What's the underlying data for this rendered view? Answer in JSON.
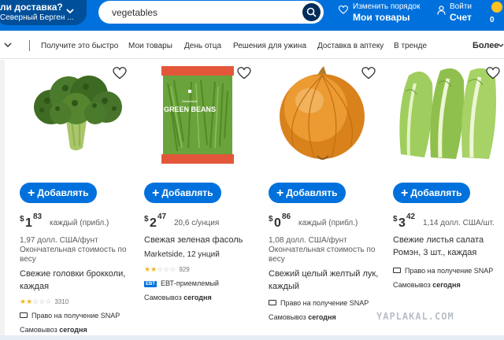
{
  "header": {
    "delivery_line1": "ли доставка?",
    "delivery_line2": "Северный Берген ...",
    "search_value": "vegetables",
    "reorder_small": "Изменить порядок",
    "reorder_big": "Мои товары",
    "account_small": "Войти",
    "account_big": "Счет",
    "cart_price": "0"
  },
  "nav": {
    "items": [
      "Получите это быстро",
      "Мои товары",
      "День отца",
      "Решения для ужина",
      "Доставка в аптеку",
      "В тренде"
    ],
    "more_label": "Более"
  },
  "products": [
    {
      "add_label": "Добавлять",
      "price_currency": "$",
      "price_dollars": "1",
      "price_cents": "83",
      "price_note": "каждый (прибл.)",
      "unit_price": "1,97 долл. США/фунт",
      "weight_note": "Окончательная стоимость по весу",
      "name": "Свежие головки брокколи, каждая",
      "rating_filled": 2,
      "rating_count": "3310",
      "snap_label": "Право на получение SNAP",
      "pickup_label": "Самовывоз",
      "pickup_when": "сегодня"
    },
    {
      "add_label": "Добавлять",
      "price_currency": "$",
      "price_dollars": "2",
      "price_cents": "47",
      "price_note": "20,6 с/унция",
      "name": "Свежая зеленая фасоль",
      "brand_line": "Marketside, 12 унций",
      "rating_filled": 2,
      "rating_count": "929",
      "ebt_tag": "EBT",
      "ebt_label": "ЕВТ-приемлемый",
      "pickup_label": "Самовывоз",
      "pickup_when": "сегодня",
      "package_brand": "Marketside",
      "package_text": "GREEN BEANS"
    },
    {
      "add_label": "Добавлять",
      "price_currency": "$",
      "price_dollars": "0",
      "price_cents": "86",
      "price_note": "каждый (прибл.)",
      "unit_price": "1,08 долл. США/фунт",
      "weight_note": "Окончательная стоимость по весу",
      "name": "Свежий целый желтый лук, каждый",
      "snap_label": "Право на получение SNAP",
      "pickup_label": "Самовывоз",
      "pickup_when": "сегодня"
    },
    {
      "add_label": "Добавлять",
      "price_currency": "$",
      "price_dollars": "3",
      "price_cents": "42",
      "price_note": "1,14 долл. США/шт.",
      "name": "Свежие листья салата Ромэн, 3 шт., каждая",
      "snap_label": "Право на получение SNAP",
      "pickup_label": "Самовывоз",
      "pickup_when": "сегодня"
    }
  ],
  "watermark": "YAPLAKAL.COM",
  "colors": {
    "brand_blue": "#0071dc",
    "dark_blue": "#004f9a",
    "search_button": "#002d58",
    "star": "#f2b51b",
    "cart_badge": "#ffc220"
  }
}
